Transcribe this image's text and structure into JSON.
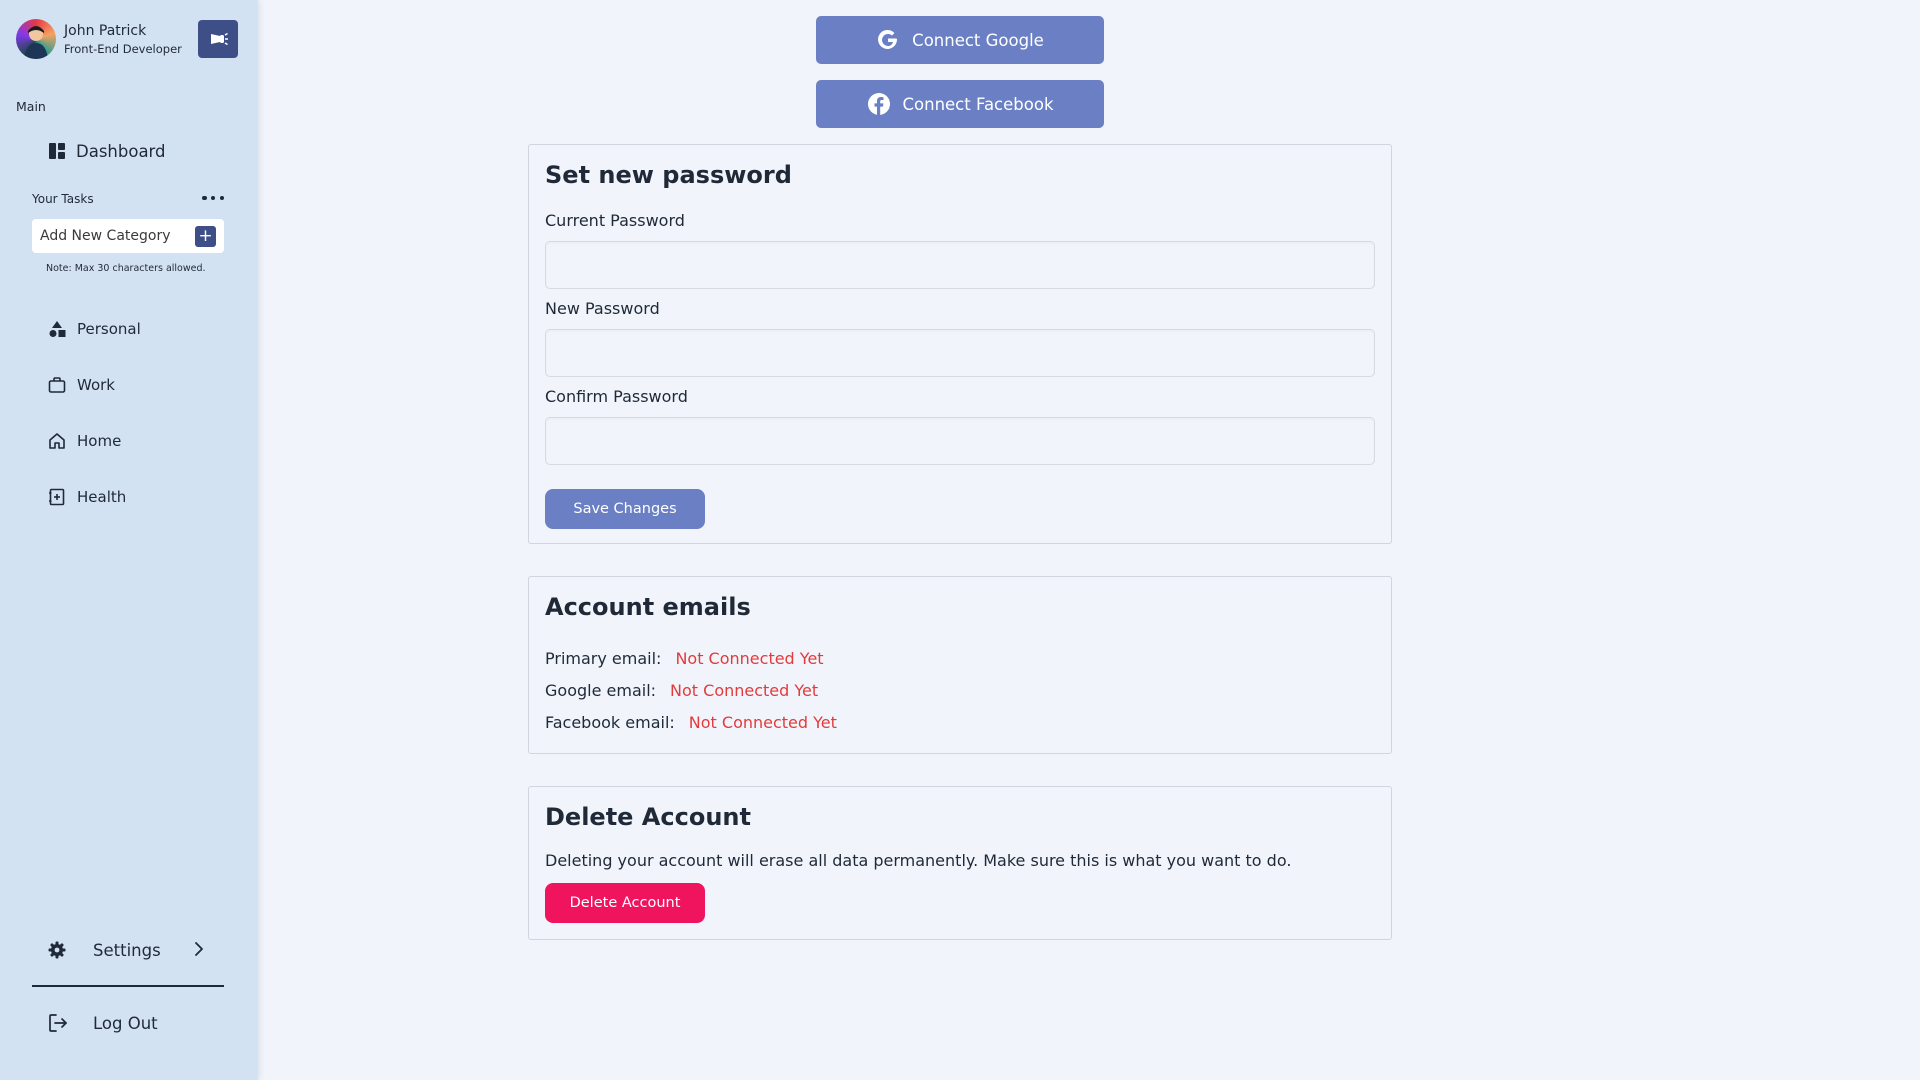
{
  "profile": {
    "name": "John Patrick",
    "role": "Front-End Developer"
  },
  "sidebar": {
    "section_main": "Main",
    "dashboard": "Dashboard",
    "tasks_title": "Your Tasks",
    "category_placeholder": "Add New Category",
    "category_note": "Note: Max 30 characters allowed.",
    "categories": [
      {
        "label": "Personal",
        "icon": "shapes-icon"
      },
      {
        "label": "Work",
        "icon": "briefcase-icon"
      },
      {
        "label": "Home",
        "icon": "house-icon"
      },
      {
        "label": "Health",
        "icon": "medical-book-icon"
      }
    ],
    "settings": "Settings",
    "logout": "Log Out"
  },
  "connect": {
    "google": "Connect Google",
    "facebook": "Connect Facebook"
  },
  "password": {
    "title": "Set new password",
    "current_label": "Current Password",
    "new_label": "New Password",
    "confirm_label": "Confirm Password",
    "current_value": "",
    "new_value": "",
    "confirm_value": "",
    "save": "Save Changes"
  },
  "emails": {
    "title": "Account emails",
    "rows": [
      {
        "label": "Primary email:",
        "value": "Not Connected Yet"
      },
      {
        "label": "Google email:",
        "value": "Not Connected Yet"
      },
      {
        "label": "Facebook email:",
        "value": "Not Connected Yet"
      }
    ]
  },
  "delete": {
    "title": "Delete Account",
    "text": "Deleting your account will erase all data permanently. Make sure this is what you want to do.",
    "button": "Delete Account"
  },
  "colors": {
    "sidebar_bg": "#d3e2f2",
    "page_bg": "#f1f5fb",
    "primary": "#6a7fc4",
    "dark_accent": "#3d4f86",
    "danger": "#f0145f",
    "warning_text": "#e23b3b"
  }
}
